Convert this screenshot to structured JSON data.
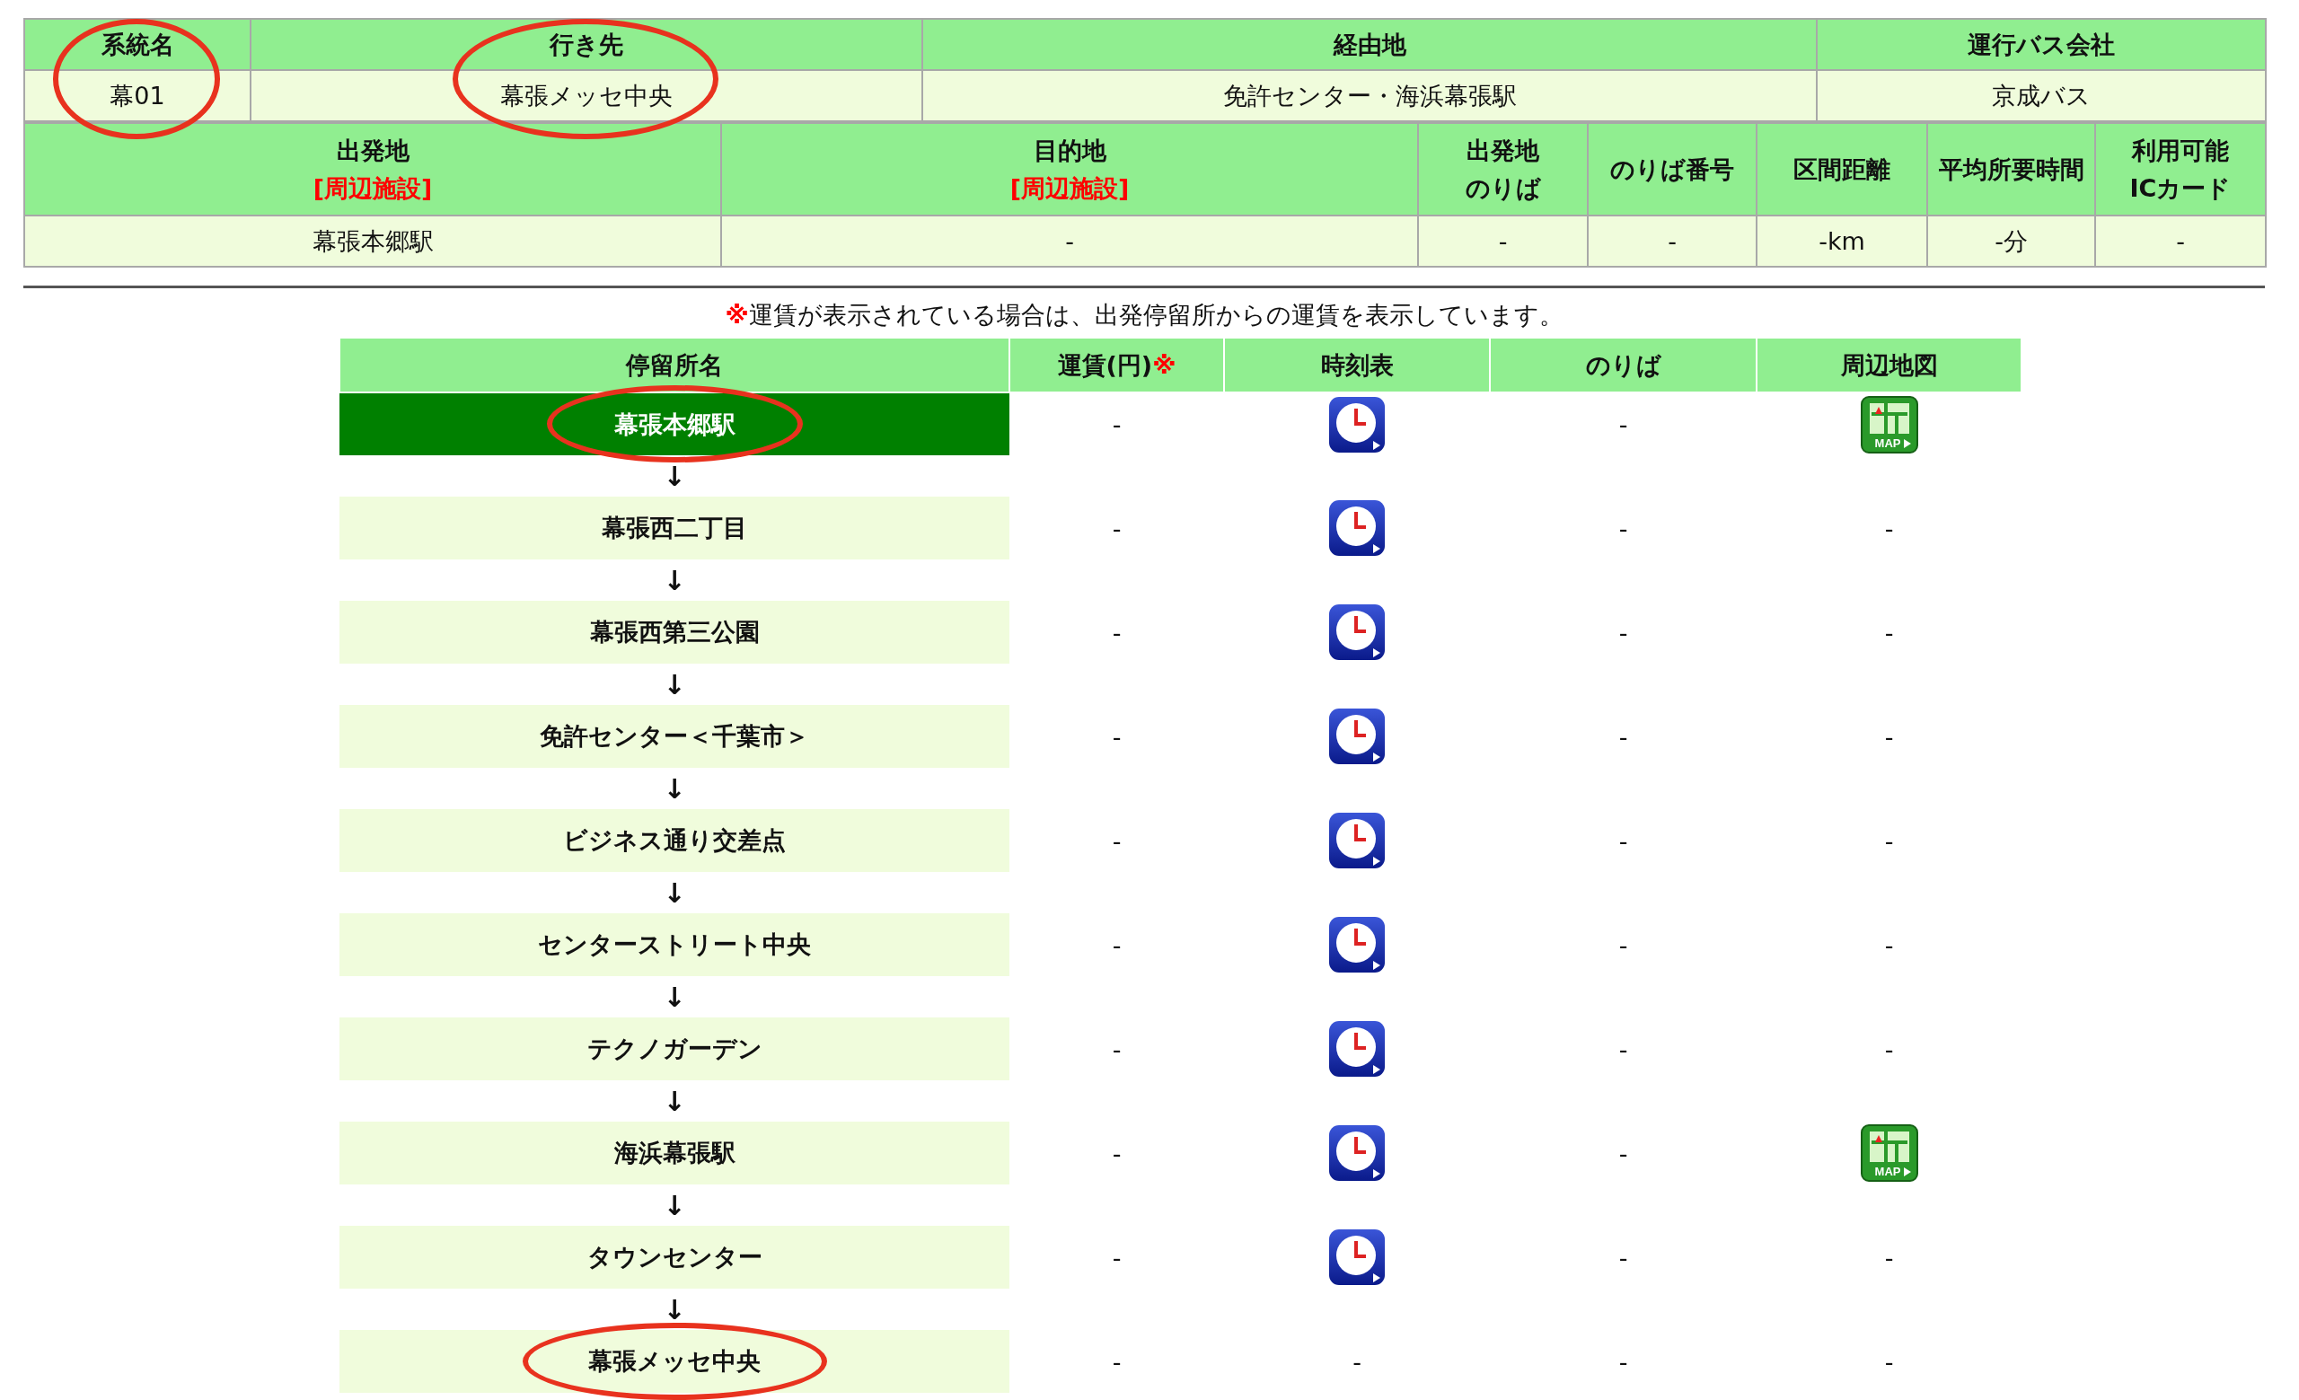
{
  "route_table": {
    "columns": [
      "系統名",
      "行き先",
      "経由地",
      "運行バス会社"
    ],
    "cells": [
      {
        "text": "幕01",
        "circled": true
      },
      {
        "text": "幕張メッセ中央",
        "circled": true
      },
      {
        "text": "免許センター・海浜幕張駅",
        "circled": false
      },
      {
        "text": "京成バス",
        "circled": false
      }
    ]
  },
  "section_table": {
    "columns": [
      {
        "lines": [
          "出発地"
        ],
        "note": "[周辺施設]"
      },
      {
        "lines": [
          "目的地"
        ],
        "note": "[周辺施設]"
      },
      {
        "lines": [
          "出発地",
          "のりば"
        ]
      },
      {
        "lines": [
          "のりば番号"
        ]
      },
      {
        "lines": [
          "区間距離"
        ]
      },
      {
        "lines": [
          "平均所要時間"
        ]
      },
      {
        "lines": [
          "利用可能",
          "ICカード"
        ]
      }
    ],
    "cells": [
      "幕張本郷駅",
      "-",
      "-",
      "-",
      "-km",
      "-分",
      "-"
    ]
  },
  "notice": {
    "mark": "※",
    "text": "運賃が表示されている場合は、出発停留所からの運賃を表示しています。"
  },
  "stops_table": {
    "columns": [
      {
        "label": "停留所名"
      },
      {
        "label": "運賃(円)",
        "mark": "※"
      },
      {
        "label": "時刻表"
      },
      {
        "label": "のりば"
      },
      {
        "label": "周辺地図"
      }
    ],
    "stops": [
      {
        "name": "幕張本郷駅",
        "selected": true,
        "circled": true,
        "fare": "-",
        "timetable": {
          "kind": "icon"
        },
        "platform": "-",
        "map": {
          "kind": "icon",
          "label": "MAP"
        },
        "arrow": "↓"
      },
      {
        "name": "幕張西二丁目",
        "selected": false,
        "circled": false,
        "fare": "-",
        "timetable": {
          "kind": "icon"
        },
        "platform": "-",
        "map": {
          "kind": "text",
          "text": "-"
        },
        "arrow": "↓"
      },
      {
        "name": "幕張西第三公園",
        "selected": false,
        "circled": false,
        "fare": "-",
        "timetable": {
          "kind": "icon"
        },
        "platform": "-",
        "map": {
          "kind": "text",
          "text": "-"
        },
        "arrow": "↓"
      },
      {
        "name": "免許センター＜千葉市＞",
        "selected": false,
        "circled": false,
        "fare": "-",
        "timetable": {
          "kind": "icon"
        },
        "platform": "-",
        "map": {
          "kind": "text",
          "text": "-"
        },
        "arrow": "↓"
      },
      {
        "name": "ビジネス通り交差点",
        "selected": false,
        "circled": false,
        "fare": "-",
        "timetable": {
          "kind": "icon"
        },
        "platform": "-",
        "map": {
          "kind": "text",
          "text": "-"
        },
        "arrow": "↓"
      },
      {
        "name": "センターストリート中央",
        "selected": false,
        "circled": false,
        "fare": "-",
        "timetable": {
          "kind": "icon"
        },
        "platform": "-",
        "map": {
          "kind": "text",
          "text": "-"
        },
        "arrow": "↓"
      },
      {
        "name": "テクノガーデン",
        "selected": false,
        "circled": false,
        "fare": "-",
        "timetable": {
          "kind": "icon"
        },
        "platform": "-",
        "map": {
          "kind": "text",
          "text": "-"
        },
        "arrow": "↓"
      },
      {
        "name": "海浜幕張駅",
        "selected": false,
        "circled": false,
        "fare": "-",
        "timetable": {
          "kind": "icon"
        },
        "platform": "-",
        "map": {
          "kind": "icon",
          "label": "MAP"
        },
        "arrow": "↓"
      },
      {
        "name": "タウンセンター",
        "selected": false,
        "circled": false,
        "fare": "-",
        "timetable": {
          "kind": "icon"
        },
        "platform": "-",
        "map": {
          "kind": "text",
          "text": "-"
        },
        "arrow": "↓"
      },
      {
        "name": "幕張メッセ中央",
        "selected": false,
        "circled": true,
        "fare": "-",
        "timetable": {
          "kind": "text",
          "text": "-"
        },
        "platform": "-",
        "map": {
          "kind": "text",
          "text": "-"
        }
      }
    ]
  }
}
